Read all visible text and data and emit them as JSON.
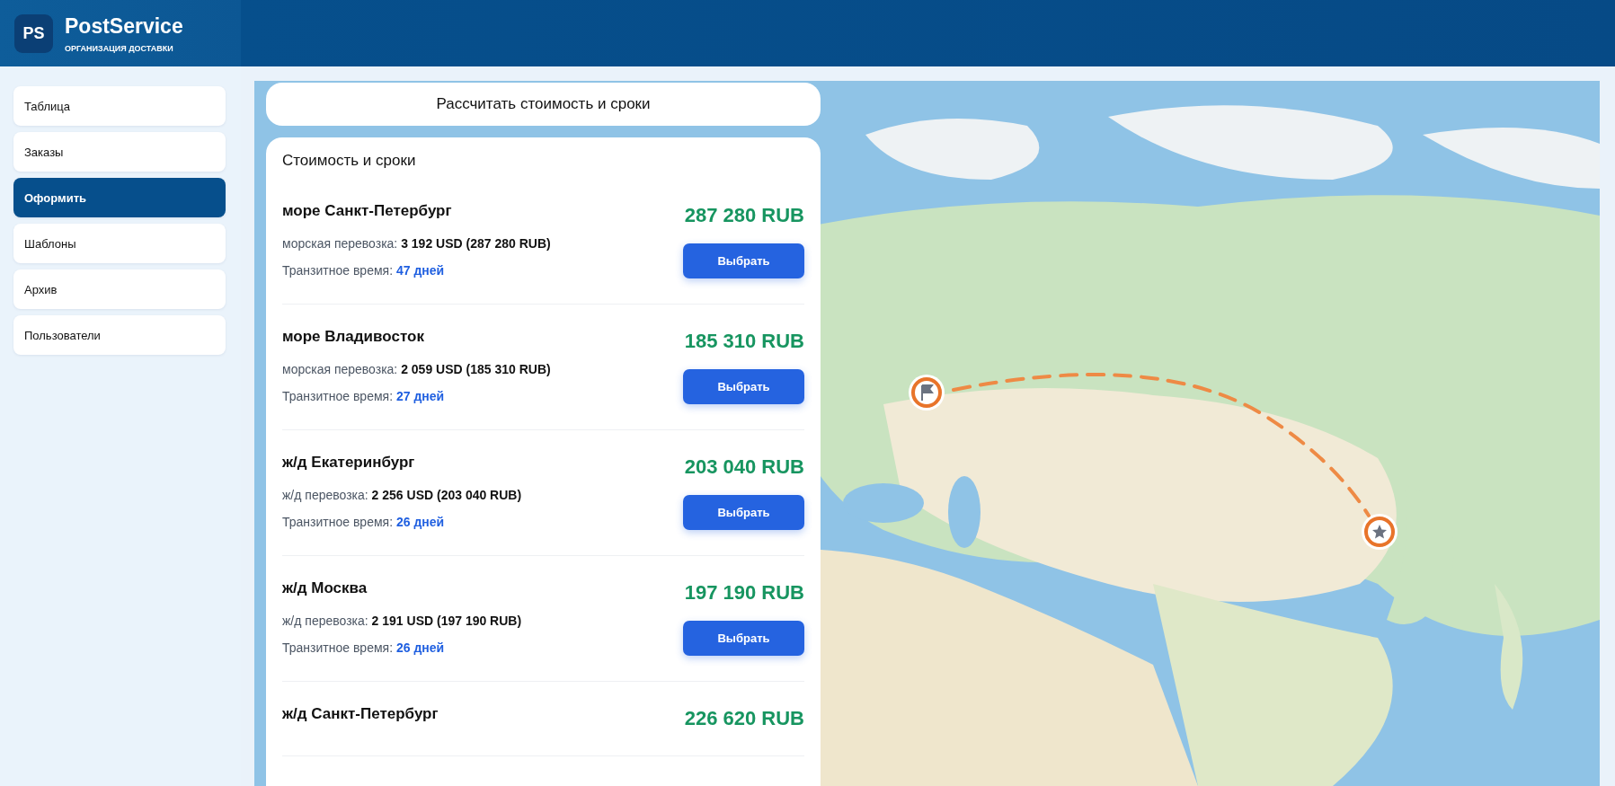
{
  "brand": {
    "logo": "PS",
    "name": "PostService",
    "subtitle": "ОРГАНИЗАЦИЯ ДОСТАВКИ"
  },
  "nav": [
    {
      "label": "Таблица",
      "selected": false
    },
    {
      "label": "Заказы",
      "selected": false
    },
    {
      "label": "Оформить",
      "selected": true
    },
    {
      "label": "Шаблоны",
      "selected": false
    },
    {
      "label": "Архив",
      "selected": false
    },
    {
      "label": "Пользователи",
      "selected": false
    }
  ],
  "calculate_button": "Рассчитать стоимость и сроки",
  "results": {
    "title": "Стоимость и сроки",
    "items": [
      {
        "title": "море Санкт-Петербург",
        "price": "287 280 RUB",
        "cost_label": "морская перевозка:",
        "cost": "3 192 USD (287 280 RUB)",
        "transit_label": "Транзитное время:",
        "transit": "47 дней",
        "button": "Выбрать"
      },
      {
        "title": "море Владивосток",
        "price": "185 310 RUB",
        "cost_label": "морская перевозка:",
        "cost": "2 059 USD (185 310 RUB)",
        "transit_label": "Транзитное время:",
        "transit": "27 дней",
        "button": "Выбрать"
      },
      {
        "title": "ж/д Екатеринбург",
        "price": "203 040 RUB",
        "cost_label": "ж/д перевозка:",
        "cost": "2 256 USD (203 040 RUB)",
        "transit_label": "Транзитное время:",
        "transit": "26 дней",
        "button": "Выбрать"
      },
      {
        "title": "ж/д Москва",
        "price": "197 190 RUB",
        "cost_label": "ж/д перевозка:",
        "cost": "2 191 USD (197 190 RUB)",
        "transit_label": "Транзитное время:",
        "transit": "26 дней",
        "button": "Выбрать"
      },
      {
        "title": "ж/д Санкт-Петербург",
        "price": "226 620 RUB"
      }
    ]
  }
}
